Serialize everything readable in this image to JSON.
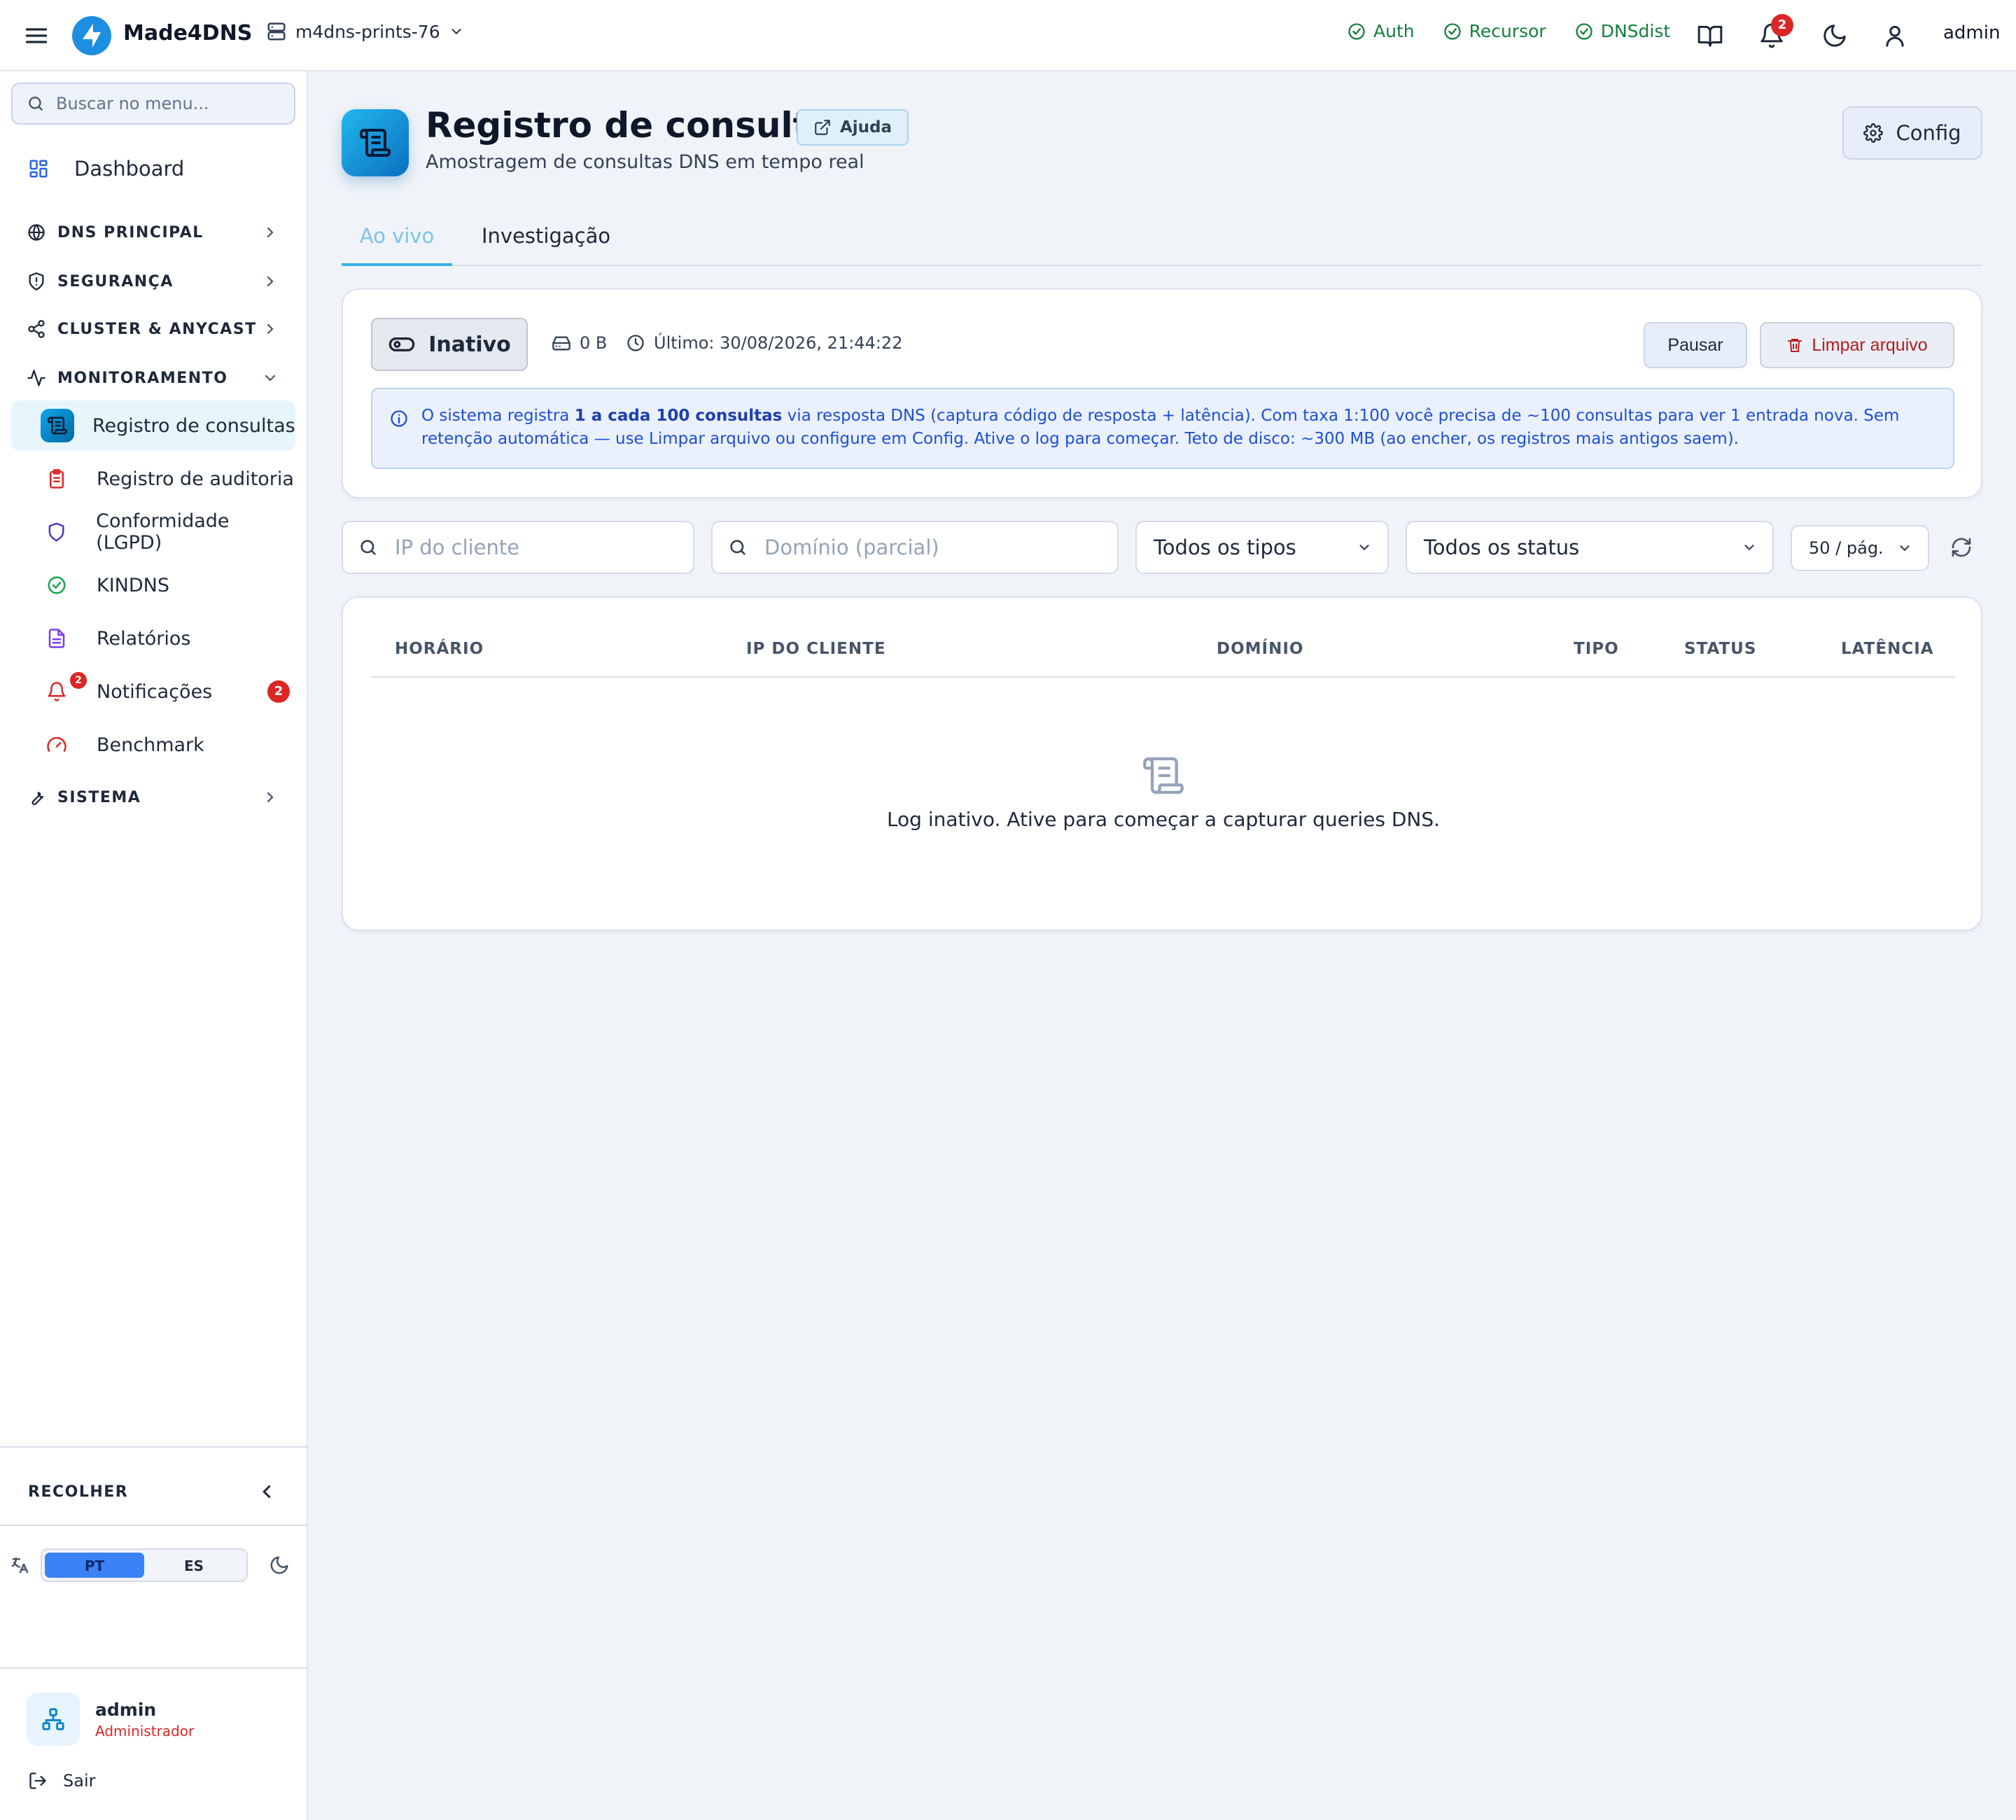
{
  "topbar": {
    "brand": "Made4DNS",
    "server": "m4dns-prints-76",
    "status_items": [
      {
        "label": "Auth",
        "state": "ok"
      },
      {
        "label": "Recursor",
        "state": "ok"
      },
      {
        "label": "DNSdist",
        "state": "ok"
      }
    ],
    "notification_count": "2",
    "user": "admin",
    "colors": {
      "ok": "#15803d",
      "badge": "#dc2626"
    }
  },
  "sidebar": {
    "search_placeholder": "Buscar no menu...",
    "dashboard": "Dashboard",
    "sections": {
      "dns_principal": "DNS PRINCIPAL",
      "seguranca": "SEGURANÇA",
      "cluster": "CLUSTER & ANYCAST",
      "monitoramento": "MONITORAMENTO",
      "sistema": "SISTEMA"
    },
    "items": [
      {
        "label": "Registro de consultas",
        "icon": "scroll-icon",
        "active": true
      },
      {
        "label": "Registro de auditoria",
        "icon": "clipboard-icon"
      },
      {
        "label": "Conformidade (LGPD)",
        "icon": "shield-icon"
      },
      {
        "label": "KINDNS",
        "icon": "check-circle-icon"
      },
      {
        "label": "Relatórios",
        "icon": "file-text-icon"
      },
      {
        "label": "Notificações",
        "icon": "bell-icon",
        "badge": "2"
      },
      {
        "label": "Benchmark",
        "icon": "gauge-icon"
      }
    ],
    "collapse": "RECOLHER",
    "languages": [
      "PT",
      "ES"
    ],
    "active_language": "PT",
    "profile": {
      "name": "admin",
      "role": "Administrador"
    },
    "logout": "Sair"
  },
  "page": {
    "title": "Registro de consultas",
    "help": "Ajuda",
    "subtitle": "Amostragem de consultas DNS em tempo real",
    "config": "Config",
    "tabs": [
      "Ao vivo",
      "Investigação"
    ],
    "active_tab": "Ao vivo"
  },
  "status_card": {
    "state": "Inativo",
    "size": "0 B",
    "last": "Último: 30/08/2026, 21:44:22",
    "pause": "Pausar",
    "clear": "Limpar arquivo",
    "info_pre": "O sistema registra ",
    "info_bold": "1 a cada 100 consultas",
    "info_post": " via resposta DNS (captura código de resposta + latência). Com taxa 1:100 você precisa de ~100 consultas para ver 1 entrada nova. Sem retenção automática — use Limpar arquivo ou configure em Config. Ative o log para começar. Teto de disco: ~300 MB (ao encher, os registros mais antigos saem)."
  },
  "filters": {
    "client_ip_placeholder": "IP do cliente",
    "domain_placeholder": "Domínio (parcial)",
    "type_selected": "Todos os tipos",
    "status_selected": "Todos os status",
    "page_size_selected": "50 / pág."
  },
  "table": {
    "columns": [
      "HORÁRIO",
      "IP DO CLIENTE",
      "DOMÍNIO",
      "TIPO",
      "STATUS",
      "LATÊNCIA"
    ],
    "rows": [],
    "empty_message": "Log inativo. Ative para começar a capturar queries DNS."
  }
}
